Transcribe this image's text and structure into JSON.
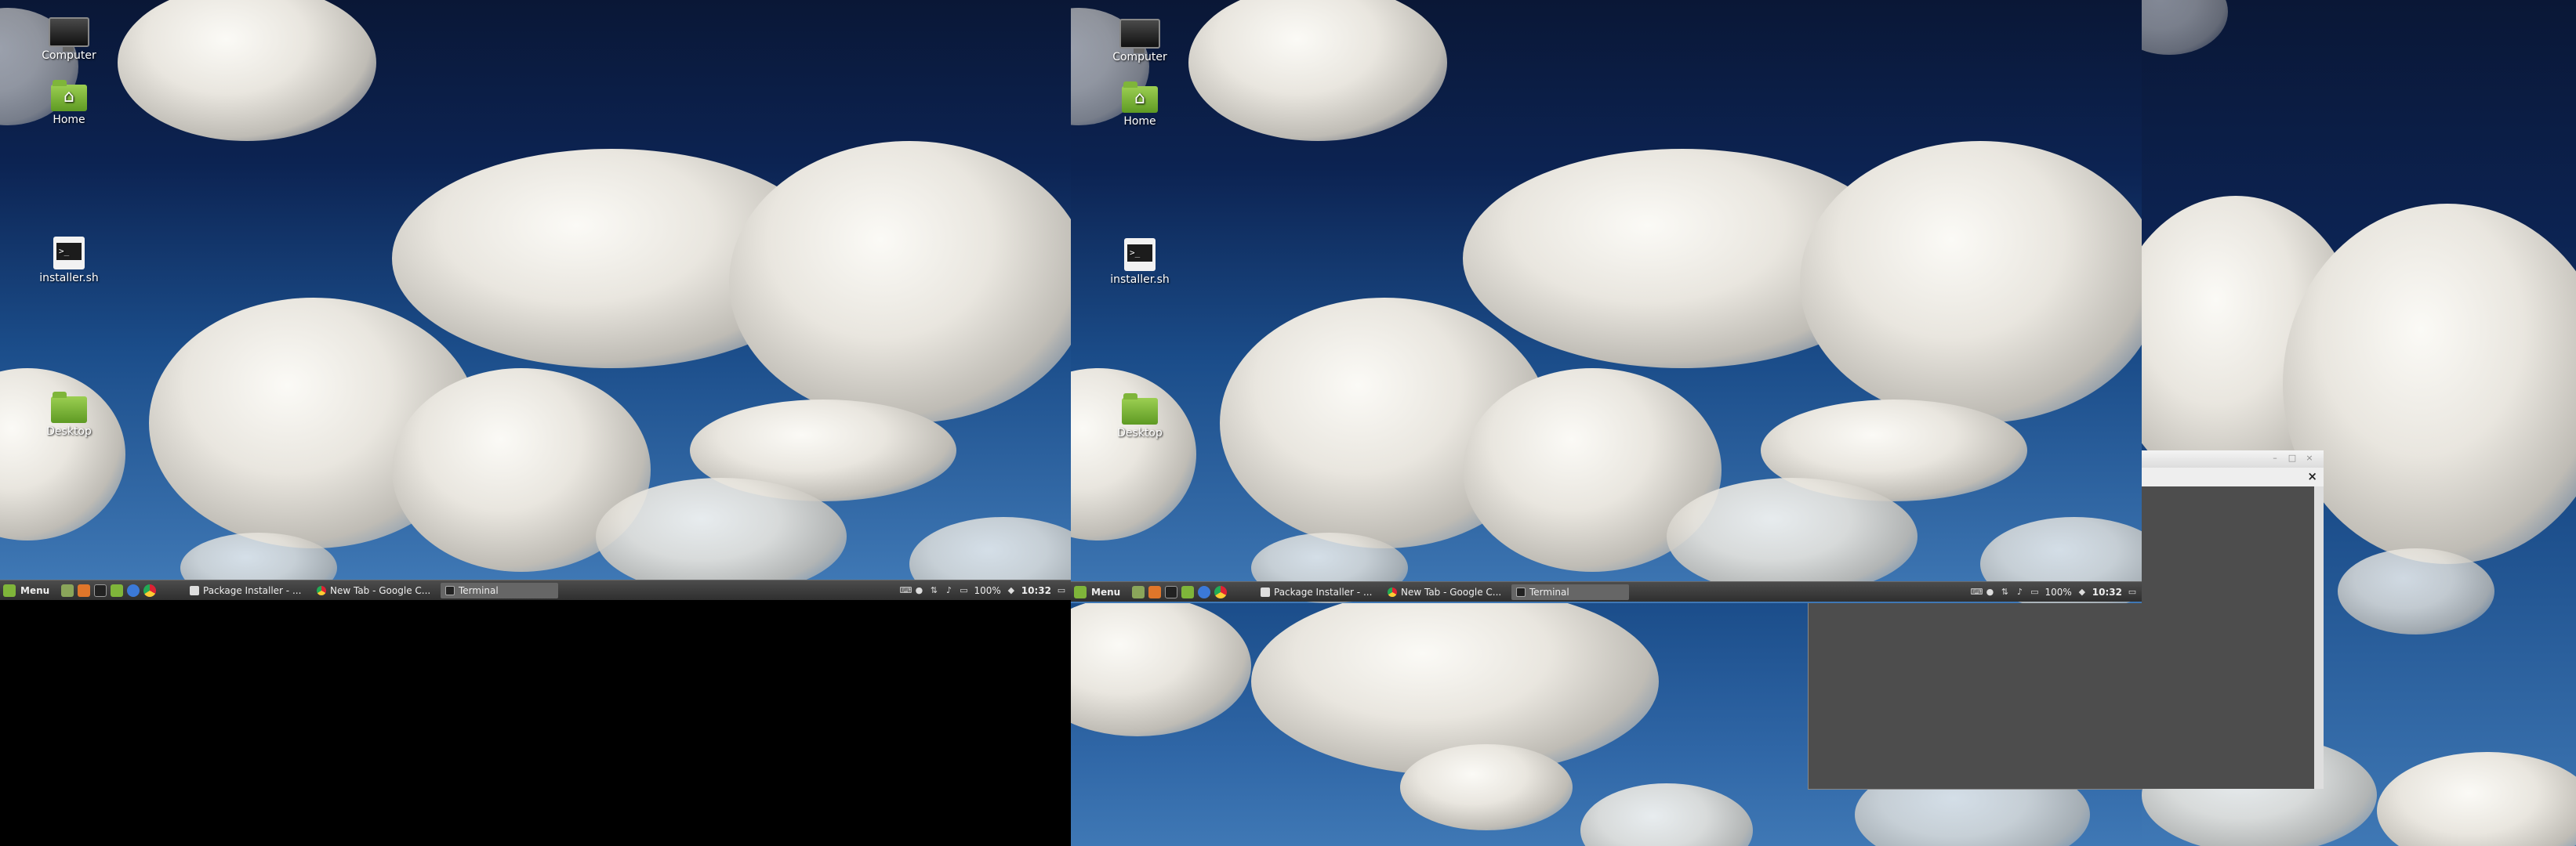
{
  "desktop_icons": [
    {
      "label": "Computer",
      "icon": "computer-icon"
    },
    {
      "label": "Home",
      "icon": "home-folder-icon"
    },
    {
      "label": "installer.sh",
      "icon": "terminal-script-icon"
    },
    {
      "label": "Desktop",
      "icon": "folder-icon"
    }
  ],
  "panel": {
    "menu_label": "Menu",
    "launchers": [
      "show-desktop-icon",
      "firefox-icon",
      "terminal-icon",
      "files-icon",
      "chrome-icon",
      "chromium-icon"
    ],
    "tasks": [
      {
        "label": "Package Installer - ...",
        "icon": "package-installer-icon",
        "active": false
      },
      {
        "label": "New Tab - Google C...",
        "icon": "chrome-icon",
        "active": false
      },
      {
        "label": "Terminal",
        "icon": "terminal-icon",
        "active": true
      }
    ],
    "tray": {
      "battery": "100%",
      "clock": "10:32"
    }
  },
  "window": {
    "tab_close": "×",
    "title_buttons": [
      "–",
      "□",
      "×"
    ]
  },
  "colors": {
    "panel": "#3c3c3c",
    "mint_green": "#7fb53a",
    "terminal_bg": "#4d4d4d"
  }
}
